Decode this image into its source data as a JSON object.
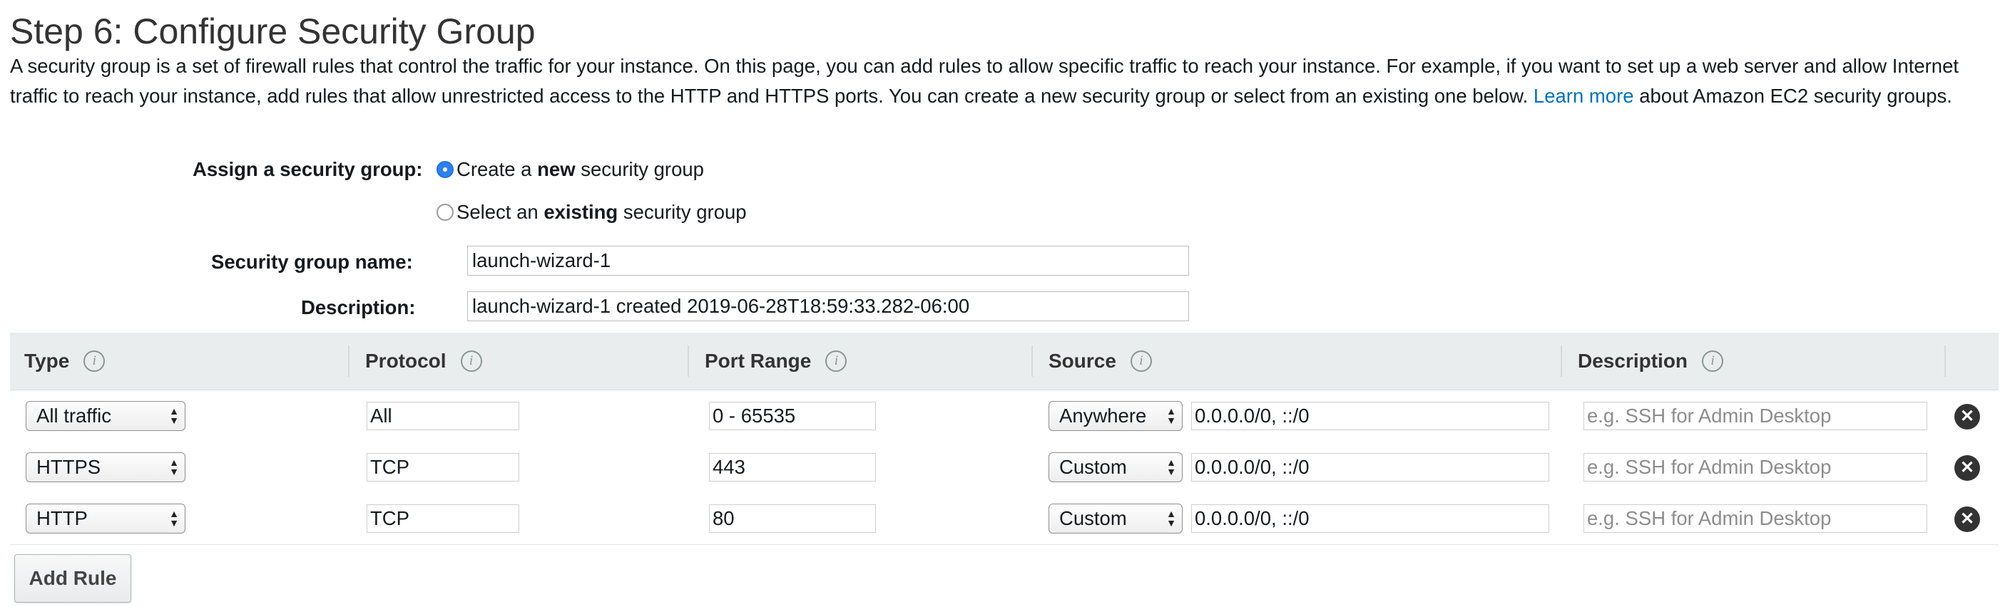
{
  "page": {
    "title": "Step 6: Configure Security Group",
    "intro_part1": "A security group is a set of firewall rules that control the traffic for your instance. On this page, you can add rules to allow specific traffic to reach your instance. For example, if you want to set up a web server and allow Internet traffic to reach your instance, add rules that allow unrestricted access to the HTTP and HTTPS ports. You can create a new security group or select from an existing one below. ",
    "intro_link": "Learn more",
    "intro_part2": " about Amazon EC2 security groups."
  },
  "assign": {
    "label": "Assign a security group:",
    "option_new_pre": "Create a ",
    "option_new_bold": "new",
    "option_new_post": " security group",
    "option_existing_pre": "Select an ",
    "option_existing_bold": "existing",
    "option_existing_post": " security group",
    "selected": "new"
  },
  "group_name": {
    "label": "Security group name:",
    "value": "launch-wizard-1"
  },
  "description": {
    "label": "Description:",
    "value": "launch-wizard-1 created 2019-06-28T18:59:33.282-06:00"
  },
  "table": {
    "headers": {
      "type": "Type",
      "protocol": "Protocol",
      "port_range": "Port Range",
      "source": "Source",
      "description": "Description"
    },
    "rows": [
      {
        "type": "All traffic",
        "protocol": "All",
        "port_range": "0 - 65535",
        "source_type": "Anywhere",
        "source_cidr": "0.0.0.0/0, ::/0",
        "description_placeholder": "e.g. SSH for Admin Desktop"
      },
      {
        "type": "HTTPS",
        "protocol": "TCP",
        "port_range": "443",
        "source_type": "Custom",
        "source_cidr": "0.0.0.0/0, ::/0",
        "description_placeholder": "e.g. SSH for Admin Desktop"
      },
      {
        "type": "HTTP",
        "protocol": "TCP",
        "port_range": "80",
        "source_type": "Custom",
        "source_cidr": "0.0.0.0/0, ::/0",
        "description_placeholder": "e.g. SSH for Admin Desktop"
      }
    ]
  },
  "add_rule_label": "Add Rule",
  "icons": {
    "info": "info-icon",
    "remove": "close-circle-icon",
    "select_arrows": "select-arrows-icon"
  },
  "colors": {
    "link": "#0073bb",
    "radio_selected": "#2f80ed",
    "header_bg": "#eaeded"
  }
}
